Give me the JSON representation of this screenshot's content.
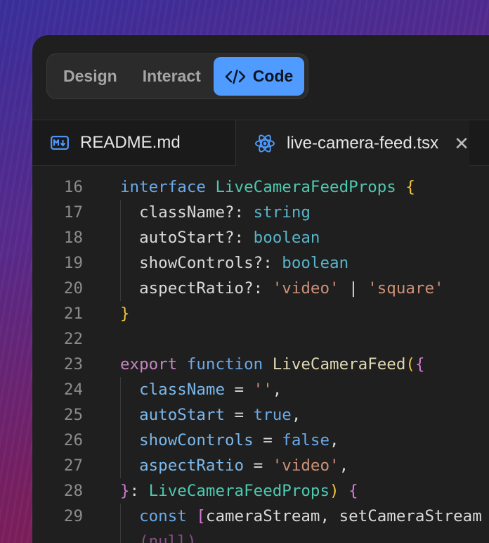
{
  "segmented": {
    "design": "Design",
    "interact": "Interact",
    "code": "Code"
  },
  "tabs": [
    {
      "label": "README.md",
      "icon": "markdown-icon"
    },
    {
      "label": "live-camera-feed.tsx",
      "icon": "react-icon",
      "close": "✕"
    }
  ],
  "editor": {
    "lines": [
      {
        "n": "16",
        "t": [
          "interface",
          " ",
          "LiveCameraFeedProps",
          " ",
          "{"
        ]
      },
      {
        "n": "17",
        "t": [
          "className?:",
          " ",
          "string"
        ]
      },
      {
        "n": "18",
        "t": [
          "autoStart?:",
          " ",
          "boolean"
        ]
      },
      {
        "n": "19",
        "t": [
          "showControls?:",
          " ",
          "boolean"
        ]
      },
      {
        "n": "20",
        "t": [
          "aspectRatio?:",
          " ",
          "'video'",
          " | ",
          "'square'"
        ]
      },
      {
        "n": "21",
        "t": [
          "}"
        ]
      },
      {
        "n": "22",
        "t": []
      },
      {
        "n": "23",
        "t": [
          "export",
          " ",
          "function",
          " ",
          "LiveCameraFeed",
          "(",
          "{"
        ]
      },
      {
        "n": "24",
        "t": [
          "className",
          " = ",
          "''",
          ","
        ]
      },
      {
        "n": "25",
        "t": [
          "autoStart",
          " = ",
          "true",
          ","
        ]
      },
      {
        "n": "26",
        "t": [
          "showControls",
          " = ",
          "false",
          ","
        ]
      },
      {
        "n": "27",
        "t": [
          "aspectRatio",
          " = ",
          "'video'",
          ","
        ]
      },
      {
        "n": "28",
        "t": [
          "}",
          ": ",
          "LiveCameraFeedProps",
          ")",
          " ",
          "{"
        ]
      },
      {
        "n": "29",
        "t": [
          "const",
          " ",
          "[",
          "cameraStream, setCameraStream"
        ]
      },
      {
        "n": "",
        "t": [
          "(null)"
        ]
      }
    ]
  }
}
